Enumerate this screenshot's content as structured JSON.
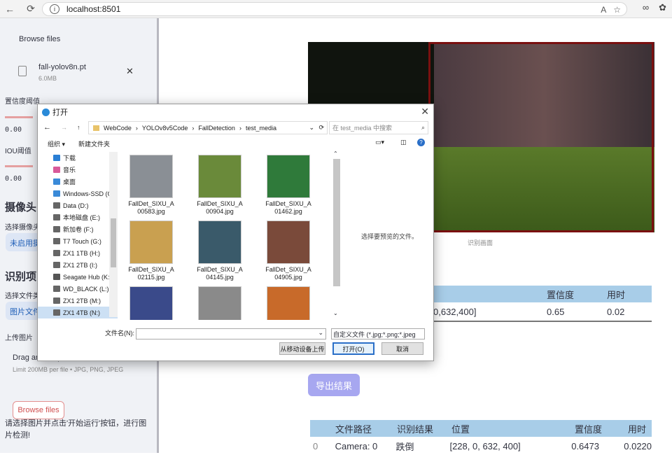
{
  "browser": {
    "url": "localhost:8501"
  },
  "sidebar": {
    "browse_files_top": "Browse files",
    "model_file": {
      "name": "fall-yolov8n.pt",
      "size": "6.0MB"
    },
    "conf_label": "置信度阈值",
    "conf_value": "0.00",
    "iou_label": "IOU阈值",
    "iou_value": "0.00",
    "camera_heading": "摄像头",
    "camera_select_label": "选择摄像头",
    "camera_pill": "未启用摄",
    "detect_heading": "识别项目",
    "file_type_label": "选择文件类",
    "file_type_pill": "图片文件",
    "upload_label": "上传图片",
    "drag_text": "Drag and drop file here",
    "limit_text": "Limit 200MB per file • JPG, PNG, JPEG",
    "browse_files_bottom": "Browse files",
    "hint": "请选择图片并点击'开始运行'按钮，进行图片检测!"
  },
  "main": {
    "video_caption": "识别画面",
    "result_table": {
      "headers": [
        "置信度",
        "用时"
      ],
      "row": {
        "position": "0,632,400]",
        "confidence": "0.65",
        "time": "0.02"
      }
    },
    "export_button": "导出结果",
    "log_table": {
      "headers": [
        "文件路径",
        "识别结果",
        "位置",
        "置信度",
        "用时"
      ],
      "row": {
        "index": "0",
        "path": "Camera: 0",
        "result": "跌倒",
        "position": "[228, 0, 632, 400]",
        "confidence": "0.6473",
        "time": "0.0220"
      }
    }
  },
  "dialog": {
    "title": "打开",
    "breadcrumbs": [
      "WebCode",
      "YOLOv8v5Code",
      "FallDetection",
      "test_media"
    ],
    "search_placeholder": "在 test_media 中搜索",
    "toolbar": {
      "organize": "组织 ▾",
      "new_folder": "新建文件夹"
    },
    "tree": [
      {
        "label": "下载",
        "color": "#2a7fd4"
      },
      {
        "label": "音乐",
        "color": "#d85a9a"
      },
      {
        "label": "桌面",
        "color": "#3a8ad8"
      },
      {
        "label": "Windows-SSD (C",
        "color": "#3a8ad8"
      },
      {
        "label": "Data (D:)",
        "color": "#666666"
      },
      {
        "label": "本地磁盘 (E:)",
        "color": "#666666"
      },
      {
        "label": "新加卷 (F:)",
        "color": "#666666"
      },
      {
        "label": "T7 Touch (G:)",
        "color": "#666666"
      },
      {
        "label": "ZX1 1TB (H:)",
        "color": "#666666"
      },
      {
        "label": "ZX1 2TB (I:)",
        "color": "#666666"
      },
      {
        "label": "Seagate Hub (K:",
        "color": "#555555"
      },
      {
        "label": "WD_BLACK (L:)",
        "color": "#666666"
      },
      {
        "label": "ZX1 2TB (M:)",
        "color": "#666666"
      },
      {
        "label": "ZX1 4TB (N:)",
        "color": "#666666"
      }
    ],
    "files": [
      {
        "l1": "FallDet_SIXU_A",
        "l2": "00583.jpg",
        "c": "#8a8f95"
      },
      {
        "l1": "FallDet_SIXU_A",
        "l2": "00904.jpg",
        "c": "#6a8a3a"
      },
      {
        "l1": "FallDet_SIXU_A",
        "l2": "01462.jpg",
        "c": "#2f7a3a"
      },
      {
        "l1": "FallDet_SIXU_A",
        "l2": "02115.jpg",
        "c": "#c9a050"
      },
      {
        "l1": "FallDet_SIXU_A",
        "l2": "04145.jpg",
        "c": "#3a5a6a"
      },
      {
        "l1": "FallDet_SIXU_A",
        "l2": "04905.jpg",
        "c": "#7a4a3a"
      },
      {
        "l1": "",
        "l2": "",
        "c": "#3a4a8a"
      },
      {
        "l1": "",
        "l2": "",
        "c": "#8a8a8a"
      },
      {
        "l1": "",
        "l2": "",
        "c": "#c86a2a"
      }
    ],
    "preview_text": "选择要预览的文件。",
    "filename_label": "文件名(N):",
    "file_type": "自定义文件 (*.jpg;*.png;*.jpeg",
    "buttons": {
      "mobile_upload": "从移动设备上传",
      "open": "打开(O)",
      "cancel": "取消"
    }
  }
}
